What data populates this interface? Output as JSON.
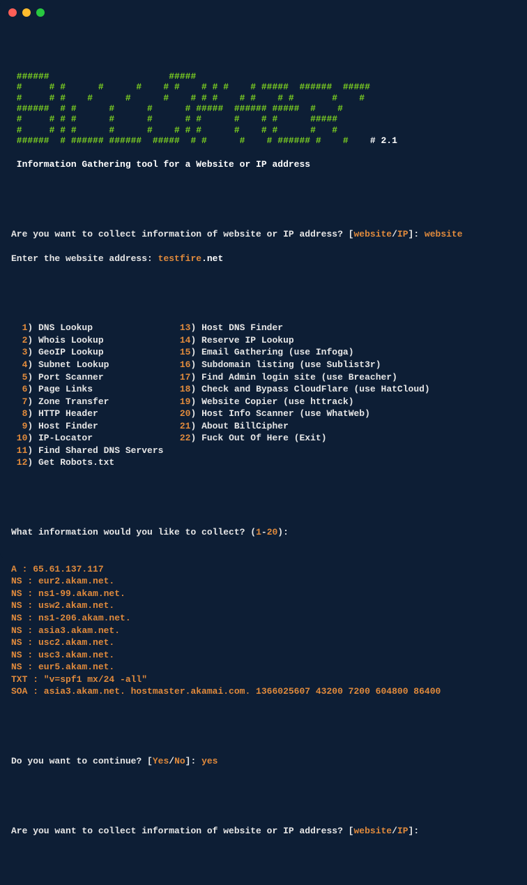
{
  "window": {
    "title": "Terminal"
  },
  "ascii": {
    "l1": " ######                      #####                                    ",
    "l2": " #     # #      #      #    # #    # # #    # #####  ######  #####    ",
    "l3": " #     # #    #      #      #    # # #    # #    # #       #    #    ",
    "l4": " ######  # #      #      #      # #####  ###### #####  #    #    ",
    "l5": " #     # # #      #      #      # #      #    # #      #####     ",
    "l6": " #     # # #      #      #    # # #      #    # #      #   #     ",
    "l7": " ######  # ###### ######  #####  # #      #    # ###### #    #   ",
    "version": "# 2.1"
  },
  "header": {
    "tagline": " Information Gathering tool for a Website or IP address"
  },
  "prompts": {
    "collect_q_pre": "Are you want to collect information of website or IP address? [",
    "website_label": "website",
    "slash": "/",
    "ip_label": "IP",
    "collect_q_post": "]: ",
    "collect_ans": "website",
    "enter_site_label": "Enter the website address: ",
    "enter_site_host": "testfire",
    "enter_site_tld": ".net",
    "what_info_pre": "What information would you like to collect? (",
    "what_info_range_low": "1",
    "what_info_dash": "-",
    "what_info_range_high": "20",
    "what_info_post": "):",
    "continue_pre": "Do you want to continue? [",
    "continue_yes": "Yes",
    "continue_no": "No",
    "continue_post": "]: ",
    "continue_ans": "yes"
  },
  "menu": {
    "left": [
      {
        "n": "1",
        "t": ") DNS Lookup"
      },
      {
        "n": "2",
        "t": ") Whois Lookup"
      },
      {
        "n": "3",
        "t": ") GeoIP Lookup"
      },
      {
        "n": "4",
        "t": ") Subnet Lookup"
      },
      {
        "n": "5",
        "t": ") Port Scanner"
      },
      {
        "n": "6",
        "t": ") Page Links"
      },
      {
        "n": "7",
        "t": ") Zone Transfer"
      },
      {
        "n": "8",
        "t": ") HTTP Header"
      },
      {
        "n": "9",
        "t": ") Host Finder"
      },
      {
        "n": "10",
        "t": ") IP-Locator"
      },
      {
        "n": "11",
        "t": ") Find Shared DNS Servers"
      },
      {
        "n": "12",
        "t": ") Get Robots.txt"
      }
    ],
    "right": [
      {
        "n": "13",
        "t": ") Host DNS Finder"
      },
      {
        "n": "14",
        "t": ") Reserve IP Lookup"
      },
      {
        "n": "15",
        "t": ") Email Gathering (use Infoga)"
      },
      {
        "n": "16",
        "t": ") Subdomain listing (use Sublist3r)"
      },
      {
        "n": "17",
        "t": ") Find Admin login site (use Breacher)"
      },
      {
        "n": "18",
        "t": ") Check and Bypass CloudFlare (use HatCloud)"
      },
      {
        "n": "19",
        "t": ") Website Copier (use httrack)"
      },
      {
        "n": "20",
        "t": ") Host Info Scanner (use WhatWeb)"
      },
      {
        "n": "21",
        "t": ") About BillCipher"
      },
      {
        "n": "22",
        "t": ") Fuck Out Of Here (Exit)"
      }
    ]
  },
  "dns_output": [
    "A : 65.61.137.117",
    "NS : eur2.akam.net.",
    "NS : ns1-99.akam.net.",
    "NS : usw2.akam.net.",
    "NS : ns1-206.akam.net.",
    "NS : asia3.akam.net.",
    "NS : usc2.akam.net.",
    "NS : usc3.akam.net.",
    "NS : eur5.akam.net.",
    "TXT : \"v=spf1 mx/24 -all\"",
    "SOA : asia3.akam.net. hostmaster.akamai.com. 1366025607 43200 7200 604800 86400"
  ]
}
